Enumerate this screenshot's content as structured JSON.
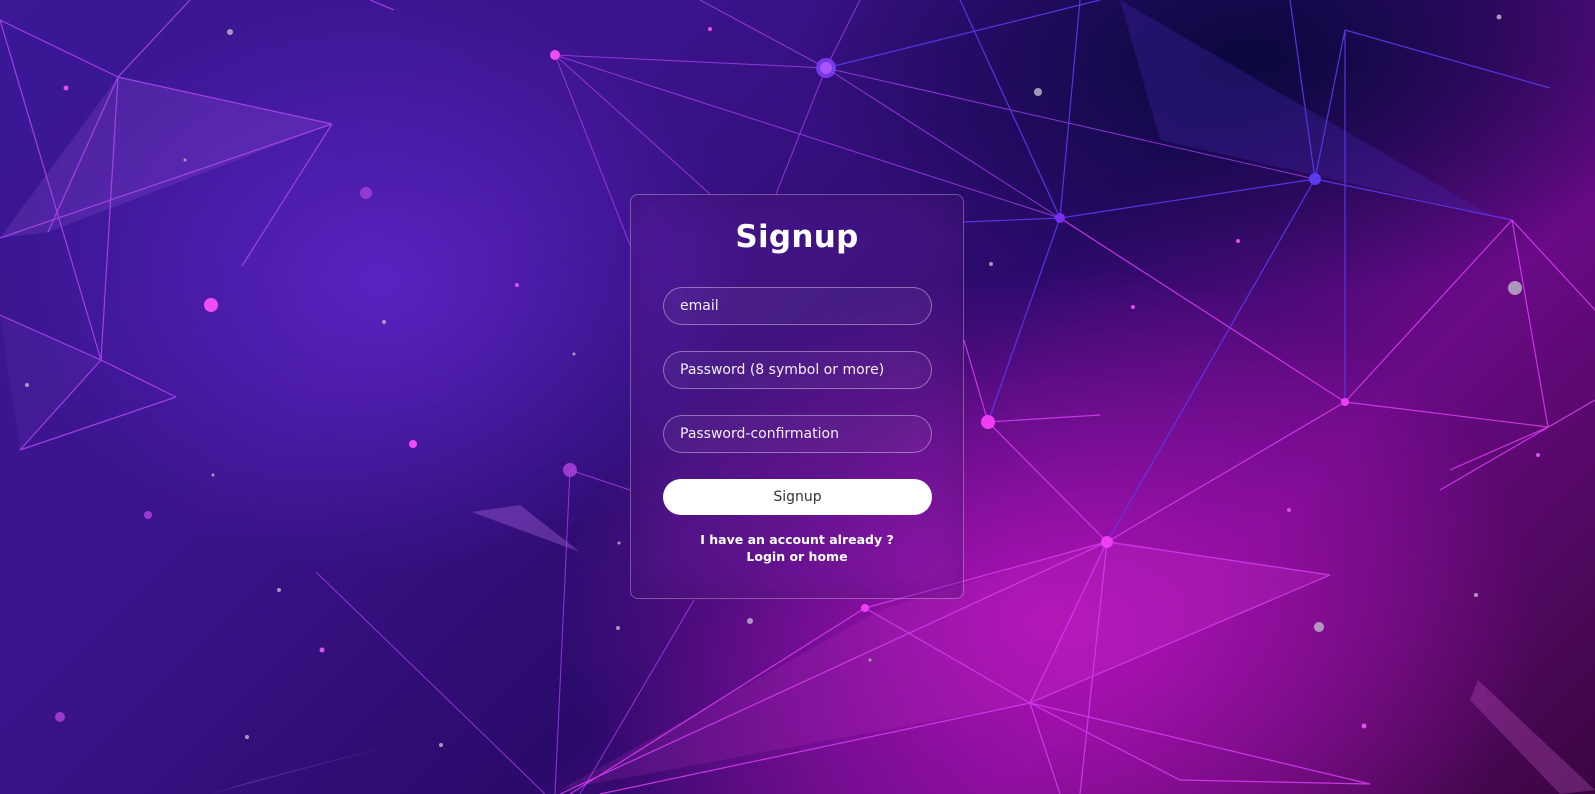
{
  "form": {
    "title": "Signup",
    "email_placeholder": "email",
    "password_placeholder": "Password (8 symbol or more)",
    "password_confirmation_placeholder": "Password-confirmation",
    "submit_label": "Signup",
    "account_text": "I have an account already ?",
    "login_link": "Login or home"
  }
}
